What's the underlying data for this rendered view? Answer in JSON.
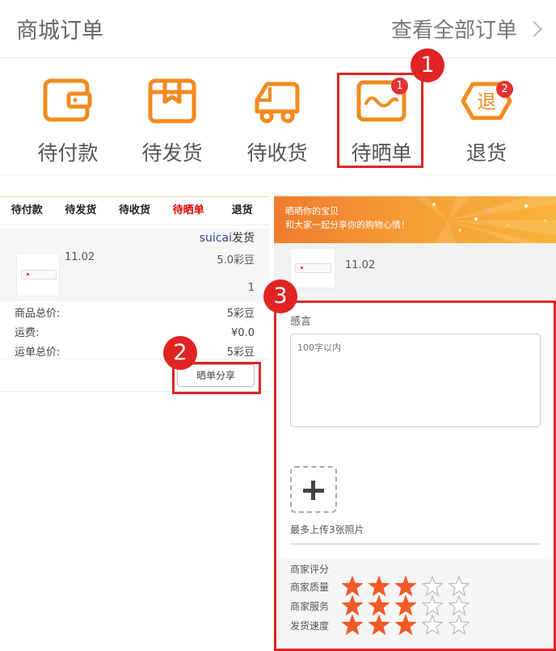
{
  "header": {
    "title": "商城订单",
    "view_all": "查看全部订单"
  },
  "icon_row": [
    {
      "label": "待付款",
      "icon": "wallet-icon"
    },
    {
      "label": "待发货",
      "icon": "box-icon"
    },
    {
      "label": "待收货",
      "icon": "truck-icon"
    },
    {
      "label": "待晒单",
      "icon": "photo-icon",
      "badge": "1"
    },
    {
      "label": "退货",
      "icon": "return-icon",
      "badge": "2"
    }
  ],
  "steps": [
    "1",
    "2",
    "3"
  ],
  "left_panel": {
    "tabs": [
      "待付款",
      "待发货",
      "待收货",
      "待晒单",
      "退货"
    ],
    "active_tab": "待晒单",
    "shop_name": "suicai",
    "shop_status": "发货",
    "goods_name": "11.02",
    "goods_price": "5.0彩豆",
    "goods_qty": "1",
    "summary": [
      {
        "label": "商品总价:",
        "value": "5彩豆"
      },
      {
        "label": "运费:",
        "value": "¥0.0"
      },
      {
        "label": "运单总价:",
        "value": "5彩豆"
      }
    ],
    "share_button": "晒单分享"
  },
  "right_panel": {
    "banner_line1": "晒晒你的宝贝",
    "banner_line2": "和大家一起分享你的购物心情！",
    "goods_name": "11.02",
    "feel_label": "感言",
    "feel_placeholder": "100字以内",
    "upload_note": "最多上传3张照片",
    "rating_title": "商家评分",
    "ratings": [
      {
        "label": "商家质量",
        "stars": 3,
        "max": 5
      },
      {
        "label": "商家服务",
        "stars": 3,
        "max": 5
      },
      {
        "label": "发货速度",
        "stars": 3,
        "max": 5
      }
    ]
  },
  "colors": {
    "accent_orange": "#f5891f",
    "highlight_red": "#e02424",
    "star_fill": "#f05a28",
    "active_tab": "#e60000"
  }
}
